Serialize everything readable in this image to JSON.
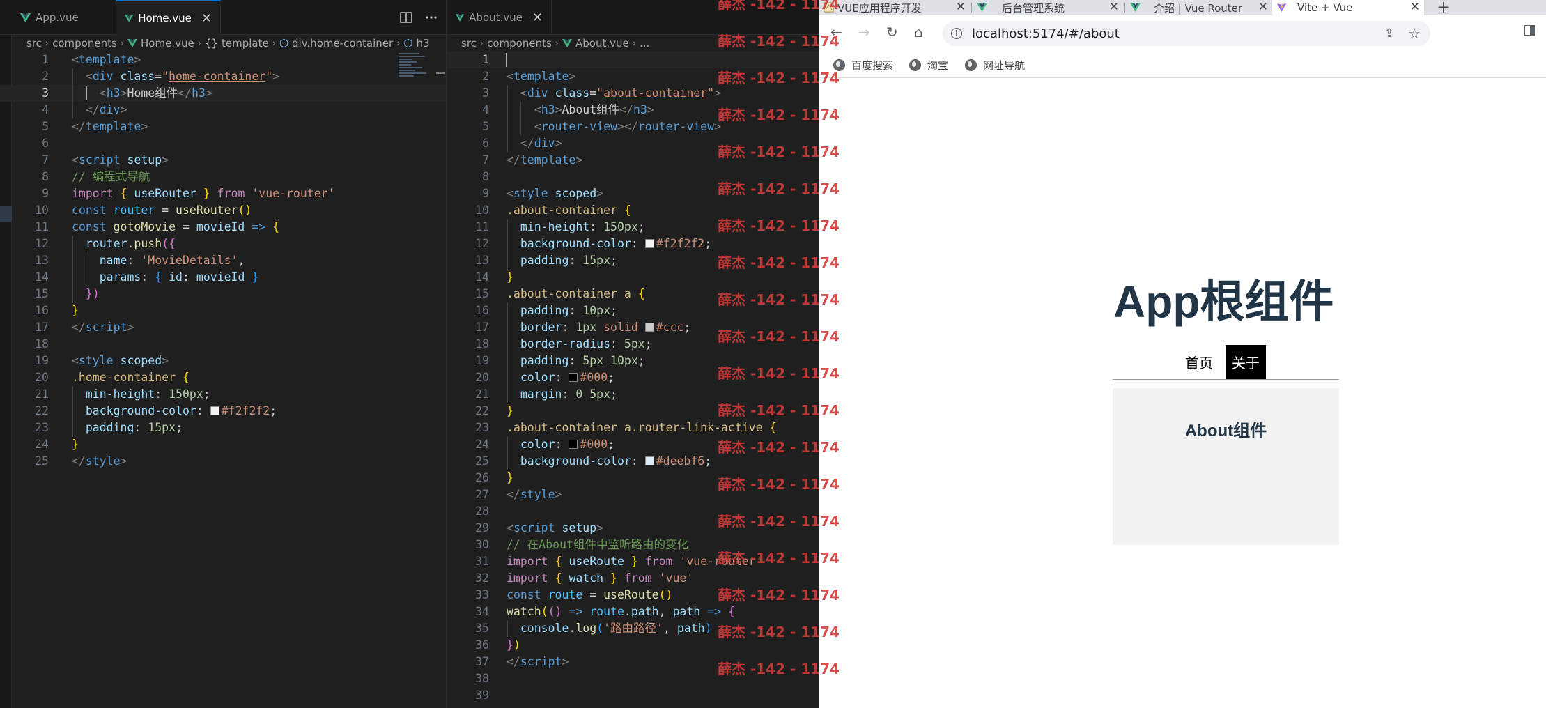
{
  "left_editor": {
    "tabs": [
      {
        "label": "App.vue",
        "active": false
      },
      {
        "label": "Home.vue",
        "active": true,
        "close": "✕"
      }
    ],
    "breadcrumbs": [
      "src",
      "components",
      "Home.vue",
      "template",
      "div.home-container",
      "h3"
    ],
    "line_numbers": [
      "1",
      "2",
      "3",
      "4",
      "5",
      "6",
      "7",
      "8",
      "9",
      "10",
      "11",
      "12",
      "13",
      "14",
      "15",
      "16",
      "17",
      "18",
      "19",
      "20",
      "21",
      "22",
      "23",
      "24",
      "25"
    ],
    "current_line": 3
  },
  "right_editor": {
    "tabs": [
      {
        "label": "About.vue",
        "active": false,
        "close": "✕"
      }
    ],
    "breadcrumbs": [
      "src",
      "components",
      "About.vue",
      "..."
    ],
    "line_numbers": [
      "1",
      "2",
      "3",
      "4",
      "5",
      "6",
      "7",
      "8",
      "9",
      "10",
      "11",
      "12",
      "13",
      "14",
      "15",
      "16",
      "17",
      "18",
      "19",
      "20",
      "21",
      "22",
      "23",
      "24",
      "25",
      "26",
      "27",
      "28",
      "29",
      "30",
      "31",
      "32",
      "33",
      "34",
      "35",
      "36",
      "37",
      "38",
      "39"
    ],
    "current_line": 1
  },
  "watermark": "薛杰 -142 - 1174",
  "browser": {
    "tabs": [
      {
        "title": "VUE应用程序开发",
        "active": false
      },
      {
        "title": "后台管理系统",
        "active": false
      },
      {
        "title": "介绍 | Vue Router",
        "active": false
      },
      {
        "title": "Vite + Vue",
        "active": true
      }
    ],
    "new_tab": "+",
    "url": "localhost:5174/#/about",
    "bookmarks": [
      "百度搜索",
      "淘宝",
      "网址导航"
    ],
    "page": {
      "title": "App根组件",
      "nav": [
        {
          "label": "首页",
          "active": false
        },
        {
          "label": "关于",
          "active": true
        }
      ],
      "content_heading": "About组件"
    }
  },
  "colors": {
    "editor_bg": "#1f1f1f",
    "accent": "#0078d4",
    "vue_green": "#41b883",
    "vue_dark": "#35495e",
    "app_text": "#213547",
    "about_bg": "#f2f2f2",
    "watermark": "#d23a3a"
  }
}
